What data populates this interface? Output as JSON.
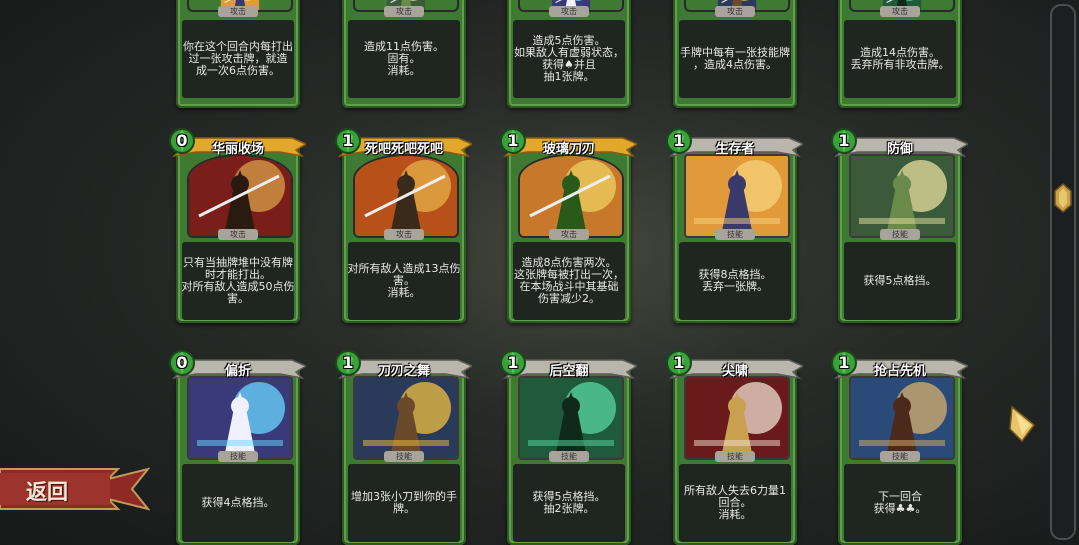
{
  "back_button": {
    "label": "返回"
  },
  "top_row": [
    {
      "type": "攻击",
      "lines": [
        "你在这个回合内每打出",
        "过一张攻击牌，就造",
        "成一次6点伤害。"
      ]
    },
    {
      "type": "攻击",
      "lines": [
        "造成11点伤害。",
        "固有。",
        "消耗。"
      ]
    },
    {
      "type": "攻击",
      "lines": [
        "造成5点伤害。",
        "如果敌人有虚弱状态，",
        "获得♠并且",
        "抽1张牌。"
      ]
    },
    {
      "type": "攻击",
      "lines": [
        "手牌中每有一张技能牌",
        "，造成4点伤害。"
      ]
    },
    {
      "type": "攻击",
      "lines": [
        "造成14点伤害。",
        "丢弃所有非攻击牌。"
      ]
    }
  ],
  "cards": [
    {
      "cost": "0",
      "title": "华丽收场",
      "type": "攻击",
      "lines": [
        "只有当抽牌堆中没有牌",
        "时才能打出。",
        "对所有敌人造成50点伤",
        "害。"
      ]
    },
    {
      "cost": "1",
      "title": "死吧死吧死吧",
      "type": "攻击",
      "lines": [
        "对所有敌人造成13点伤",
        "害。",
        "消耗。"
      ]
    },
    {
      "cost": "1",
      "title": "玻璃刀刃",
      "type": "攻击",
      "lines": [
        "造成8点伤害两次。",
        "这张牌每被打出一次，",
        "在本场战斗中其基础",
        "伤害减少2。"
      ]
    },
    {
      "cost": "1",
      "title": "生存者",
      "type": "技能",
      "lines": [
        "获得8点格挡。",
        "丢弃一张牌。"
      ]
    },
    {
      "cost": "1",
      "title": "防御",
      "type": "技能",
      "lines": [
        "获得5点格挡。"
      ]
    },
    {
      "cost": "0",
      "title": "偏折",
      "type": "技能",
      "lines": [
        "获得4点格挡。"
      ]
    },
    {
      "cost": "1",
      "title": "刀刃之舞",
      "type": "技能",
      "lines": [
        "增加3张小刀到你的手",
        "牌。"
      ]
    },
    {
      "cost": "1",
      "title": "后空翻",
      "type": "技能",
      "lines": [
        "获得5点格挡。",
        "抽2张牌。"
      ]
    },
    {
      "cost": "1",
      "title": "尖啸",
      "type": "技能",
      "lines": [
        "所有敌人失去6力量1",
        "回合。",
        "消耗。"
      ]
    },
    {
      "cost": "1",
      "title": "抢占先机",
      "type": "技能",
      "lines": [
        "下一回合",
        "获得♣♣。"
      ]
    }
  ],
  "colors": {
    "card_green": "#3f7a32",
    "keyword_gold": "#f2c94c",
    "back_red": "#8e2a24"
  }
}
